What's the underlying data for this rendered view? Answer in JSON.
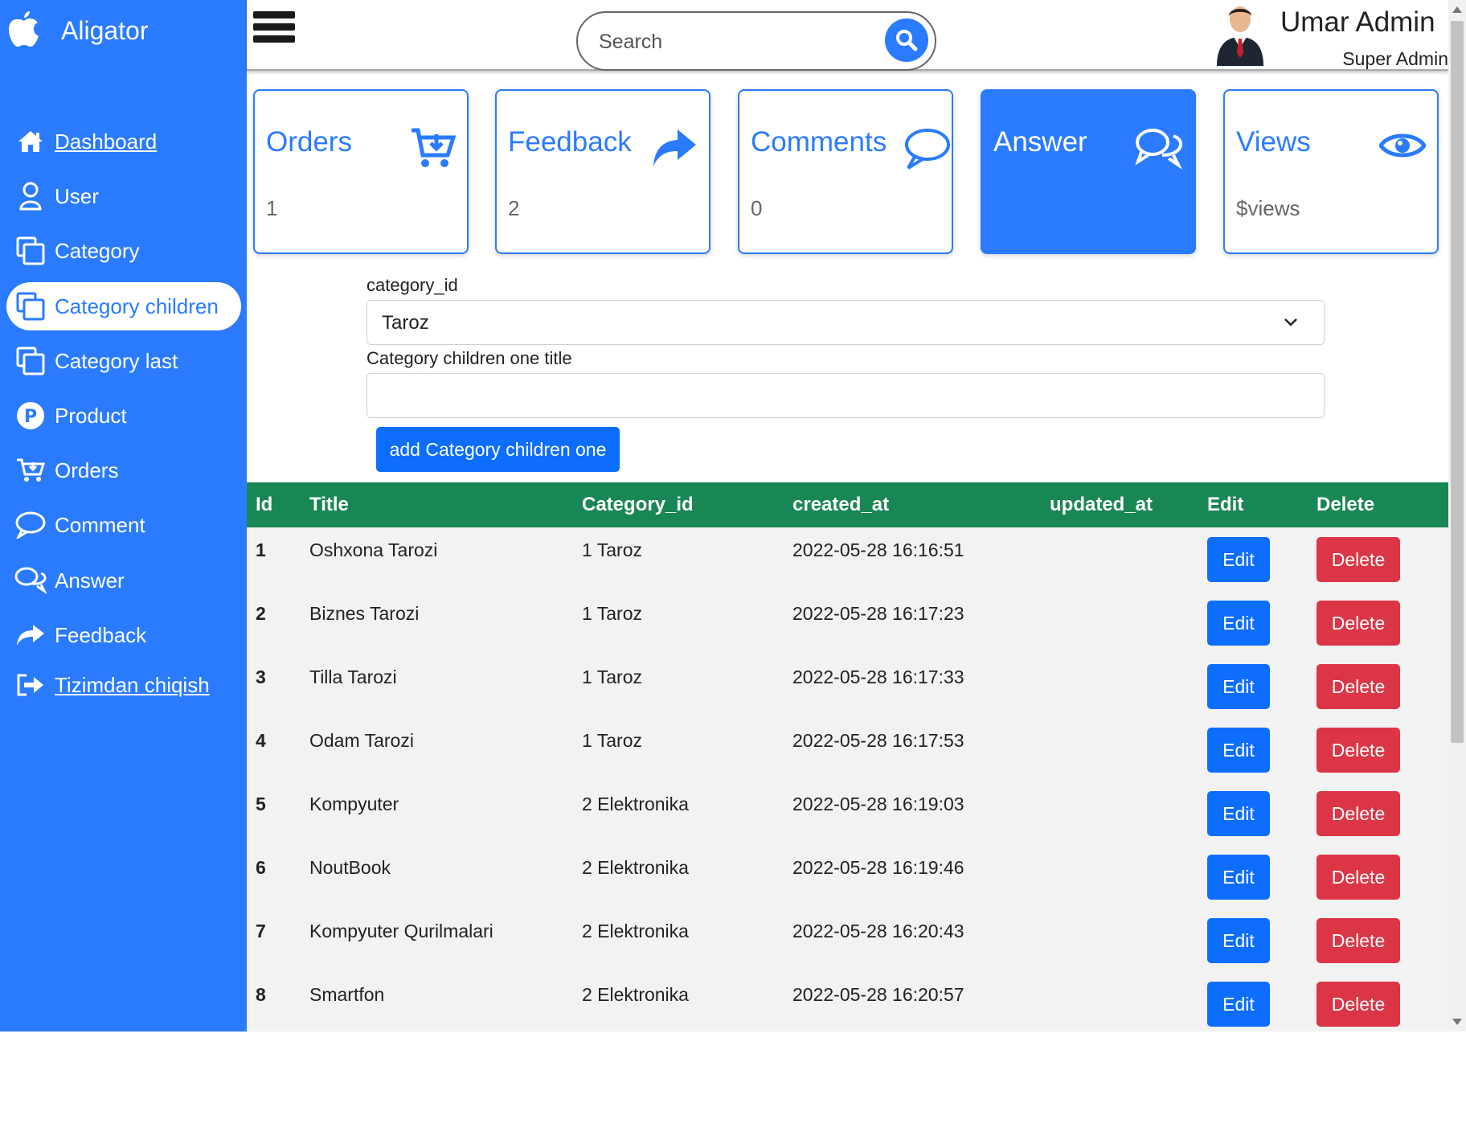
{
  "brand": {
    "name": "Aligator",
    "icon": "apple-logo"
  },
  "sidebar": {
    "items": [
      {
        "label": "Dashboard",
        "icon": "home-icon",
        "underline": true
      },
      {
        "label": "User",
        "icon": "user-icon"
      },
      {
        "label": "Category",
        "icon": "copy-icon"
      },
      {
        "label": "Category children",
        "icon": "copy-icon",
        "active": true
      },
      {
        "label": "Category last",
        "icon": "copy-icon"
      },
      {
        "label": "Product",
        "icon": "product-p-icon"
      },
      {
        "label": "Orders",
        "icon": "cart-icon"
      },
      {
        "label": "Comment",
        "icon": "comment-icon"
      },
      {
        "label": "Answer",
        "icon": "comments-icon"
      },
      {
        "label": "Feedback",
        "icon": "share-arrow-icon"
      },
      {
        "label": "Tizimdan chiqish",
        "icon": "logout-icon",
        "underline": true
      }
    ]
  },
  "header": {
    "search_placeholder": "Search",
    "user_name": "Umar Admin",
    "user_role": "Super Admin"
  },
  "cards": [
    {
      "title": "Orders",
      "value": "1",
      "icon": "cart-download-icon"
    },
    {
      "title": "Feedback",
      "value": "2",
      "icon": "share-arrow-icon"
    },
    {
      "title": "Comments",
      "value": "0",
      "icon": "comment-icon"
    },
    {
      "title": "Answer",
      "value": "",
      "icon": "comments-icon",
      "filled": true
    },
    {
      "title": "Views",
      "value": "$views",
      "icon": "eye-icon"
    }
  ],
  "form": {
    "category_label": "category_id",
    "category_selected": "Taroz",
    "title_label": "Category children one title",
    "title_value": "",
    "submit_label": "add Category children one"
  },
  "table": {
    "headers": [
      "Id",
      "Title",
      "Category_id",
      "created_at",
      "updated_at",
      "Edit",
      "Delete"
    ],
    "edit_label": "Edit",
    "delete_label": "Delete",
    "rows": [
      {
        "id": "1",
        "title": "Oshxona Tarozi",
        "category": "1 Taroz",
        "created_at": "2022-05-28 16:16:51",
        "updated_at": ""
      },
      {
        "id": "2",
        "title": "Biznes Tarozi",
        "category": "1 Taroz",
        "created_at": "2022-05-28 16:17:23",
        "updated_at": ""
      },
      {
        "id": "3",
        "title": "Tilla Tarozi",
        "category": "1 Taroz",
        "created_at": "2022-05-28 16:17:33",
        "updated_at": ""
      },
      {
        "id": "4",
        "title": "Odam Tarozi",
        "category": "1 Taroz",
        "created_at": "2022-05-28 16:17:53",
        "updated_at": ""
      },
      {
        "id": "5",
        "title": "Kompyuter",
        "category": "2 Elektronika",
        "created_at": "2022-05-28 16:19:03",
        "updated_at": ""
      },
      {
        "id": "6",
        "title": "NoutBook",
        "category": "2 Elektronika",
        "created_at": "2022-05-28 16:19:46",
        "updated_at": ""
      },
      {
        "id": "7",
        "title": "Kompyuter Qurilmalari",
        "category": "2 Elektronika",
        "created_at": "2022-05-28 16:20:43",
        "updated_at": ""
      },
      {
        "id": "8",
        "title": "Smartfon",
        "category": "2 Elektronika",
        "created_at": "2022-05-28 16:20:57",
        "updated_at": ""
      }
    ]
  },
  "colors": {
    "primary": "#2a7bff",
    "button_primary": "#0d6efd",
    "danger": "#dc3545",
    "table_header": "#198754",
    "table_body": "#f2f2f2"
  }
}
